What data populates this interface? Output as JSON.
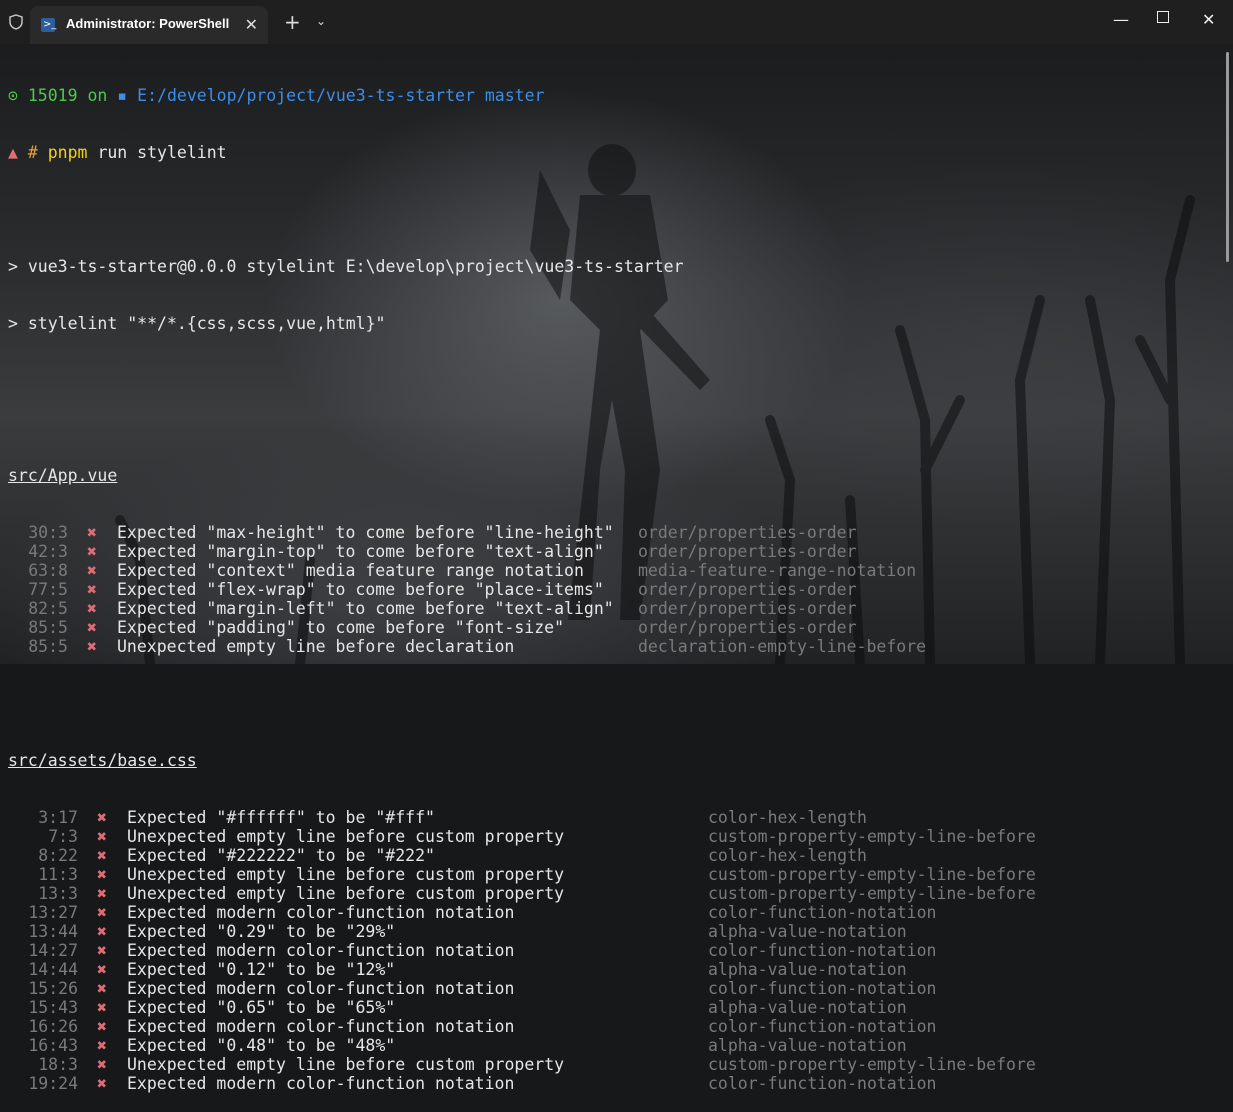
{
  "window": {
    "tab_title": "Administrator: PowerShell",
    "new_tab": "+",
    "dropdown": "⌄",
    "minimize": "—",
    "close": "✕"
  },
  "prompt": {
    "symbol": "⊙",
    "number": "15019",
    "on": "on",
    "folder_icon": "▪",
    "path": "E:/develop/project/vue3-ts-starter",
    "branch_icon": "",
    "branch": "master",
    "prompt_icon": "▲",
    "hash": "#",
    "command_pnpm": "pnpm",
    "command_rest": "run stylelint"
  },
  "output": {
    "line1": "> vue3-ts-starter@0.0.0 stylelint E:\\develop\\project\\vue3-ts-starter",
    "line2": "> stylelint \"**/*.{css,scss,vue,html}\""
  },
  "groups": [
    {
      "file": "src/App.vue",
      "rows": [
        {
          "pos": "30:3",
          "msg": "Expected \"max-height\" to come before \"line-height\"",
          "rule": "order/properties-order"
        },
        {
          "pos": "42:3",
          "msg": "Expected \"margin-top\" to come before \"text-align\"",
          "rule": "order/properties-order"
        },
        {
          "pos": "63:8",
          "msg": "Expected \"context\" media feature range notation",
          "rule": "media-feature-range-notation"
        },
        {
          "pos": "77:5",
          "msg": "Expected \"flex-wrap\" to come before \"place-items\"",
          "rule": "order/properties-order"
        },
        {
          "pos": "82:5",
          "msg": "Expected \"margin-left\" to come before \"text-align\"",
          "rule": "order/properties-order"
        },
        {
          "pos": "85:5",
          "msg": "Expected \"padding\" to come before \"font-size\"",
          "rule": "order/properties-order"
        },
        {
          "pos": "85:5",
          "msg": "Unexpected empty line before declaration",
          "rule": "declaration-empty-line-before"
        }
      ]
    },
    {
      "file": "src/assets/base.css",
      "rows": [
        {
          "pos": "3:17",
          "msg": "Expected \"#ffffff\" to be \"#fff\"",
          "rule": "color-hex-length"
        },
        {
          "pos": "7:3",
          "msg": "Unexpected empty line before custom property",
          "rule": "custom-property-empty-line-before"
        },
        {
          "pos": "8:22",
          "msg": "Expected \"#222222\" to be \"#222\"",
          "rule": "color-hex-length"
        },
        {
          "pos": "11:3",
          "msg": "Unexpected empty line before custom property",
          "rule": "custom-property-empty-line-before"
        },
        {
          "pos": "13:3",
          "msg": "Unexpected empty line before custom property",
          "rule": "custom-property-empty-line-before"
        },
        {
          "pos": "13:27",
          "msg": "Expected modern color-function notation",
          "rule": "color-function-notation"
        },
        {
          "pos": "13:44",
          "msg": "Expected \"0.29\" to be \"29%\"",
          "rule": "alpha-value-notation"
        },
        {
          "pos": "14:27",
          "msg": "Expected modern color-function notation",
          "rule": "color-function-notation"
        },
        {
          "pos": "14:44",
          "msg": "Expected \"0.12\" to be \"12%\"",
          "rule": "alpha-value-notation"
        },
        {
          "pos": "15:26",
          "msg": "Expected modern color-function notation",
          "rule": "color-function-notation"
        },
        {
          "pos": "15:43",
          "msg": "Expected \"0.65\" to be \"65%\"",
          "rule": "alpha-value-notation"
        },
        {
          "pos": "16:26",
          "msg": "Expected modern color-function notation",
          "rule": "color-function-notation"
        },
        {
          "pos": "16:43",
          "msg": "Expected \"0.48\" to be \"48%\"",
          "rule": "alpha-value-notation"
        },
        {
          "pos": "18:3",
          "msg": "Unexpected empty line before custom property",
          "rule": "custom-property-empty-line-before"
        },
        {
          "pos": "19:24",
          "msg": "Expected modern color-function notation",
          "rule": "color-function-notation"
        }
      ]
    }
  ],
  "error_mark": "✖"
}
